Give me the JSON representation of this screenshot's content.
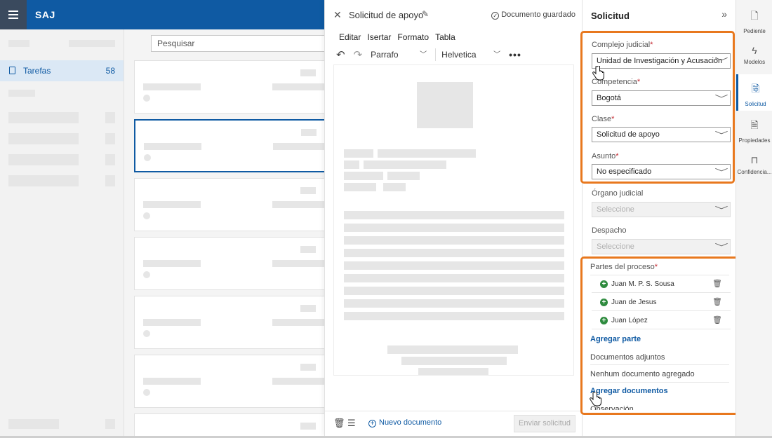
{
  "app": {
    "brand": "SAJ"
  },
  "left_nav": {
    "tasks_label": "Tarefas",
    "tasks_count": "58"
  },
  "list": {
    "search_placeholder": "Pesquisar"
  },
  "editor": {
    "title": "Solicitud de apoyo",
    "saved_status": "Documento guardado",
    "menus": [
      "Editar",
      "Isertar",
      "Formato",
      "Tabla"
    ],
    "paragraph_style": "Parrafo",
    "font": "Helvetica",
    "new_document_label": "Nuevo documento",
    "send_label": "Enviar solicitud"
  },
  "form": {
    "title": "Solicitud",
    "fields": {
      "complejo": {
        "label": "Complejo judicial",
        "value": "Unidad de Investigación y Acusación"
      },
      "competencia": {
        "label": "Competencia",
        "value": "Bogotá"
      },
      "clase": {
        "label": "Clase",
        "value": "Solicitud de apoyo"
      },
      "asunto": {
        "label": "Asunto",
        "value": "No especificado"
      },
      "organo": {
        "label": "Órgano judicial",
        "placeholder": "Seleccione"
      },
      "despacho": {
        "label": "Despacho",
        "placeholder": "Seleccione"
      }
    },
    "parties_label": "Partes del proceso",
    "parties": [
      "Juan M. P. S. Sousa",
      "Juan de Jesus",
      "Juan López"
    ],
    "add_party": "Agregar parte",
    "attachments_label": "Documentos adjuntos",
    "no_documents": "Nenhum documento agregado",
    "add_documents": "Agregar documentos",
    "observation_label": "Observación"
  },
  "rail": [
    {
      "label": "Pediente",
      "icon": "document-clock-icon"
    },
    {
      "label": "Modelos",
      "icon": "lightning-icon"
    },
    {
      "label": "Solicitud",
      "icon": "document-search-icon"
    },
    {
      "label": "Propiedades",
      "icon": "document-properties-icon"
    },
    {
      "label": "Confidencia...",
      "icon": "lock-icon"
    }
  ],
  "colors": {
    "brand": "#0f5aa3",
    "highlight": "#e8781e",
    "required": "#c4262e",
    "party_add": "#2e8b3e"
  }
}
